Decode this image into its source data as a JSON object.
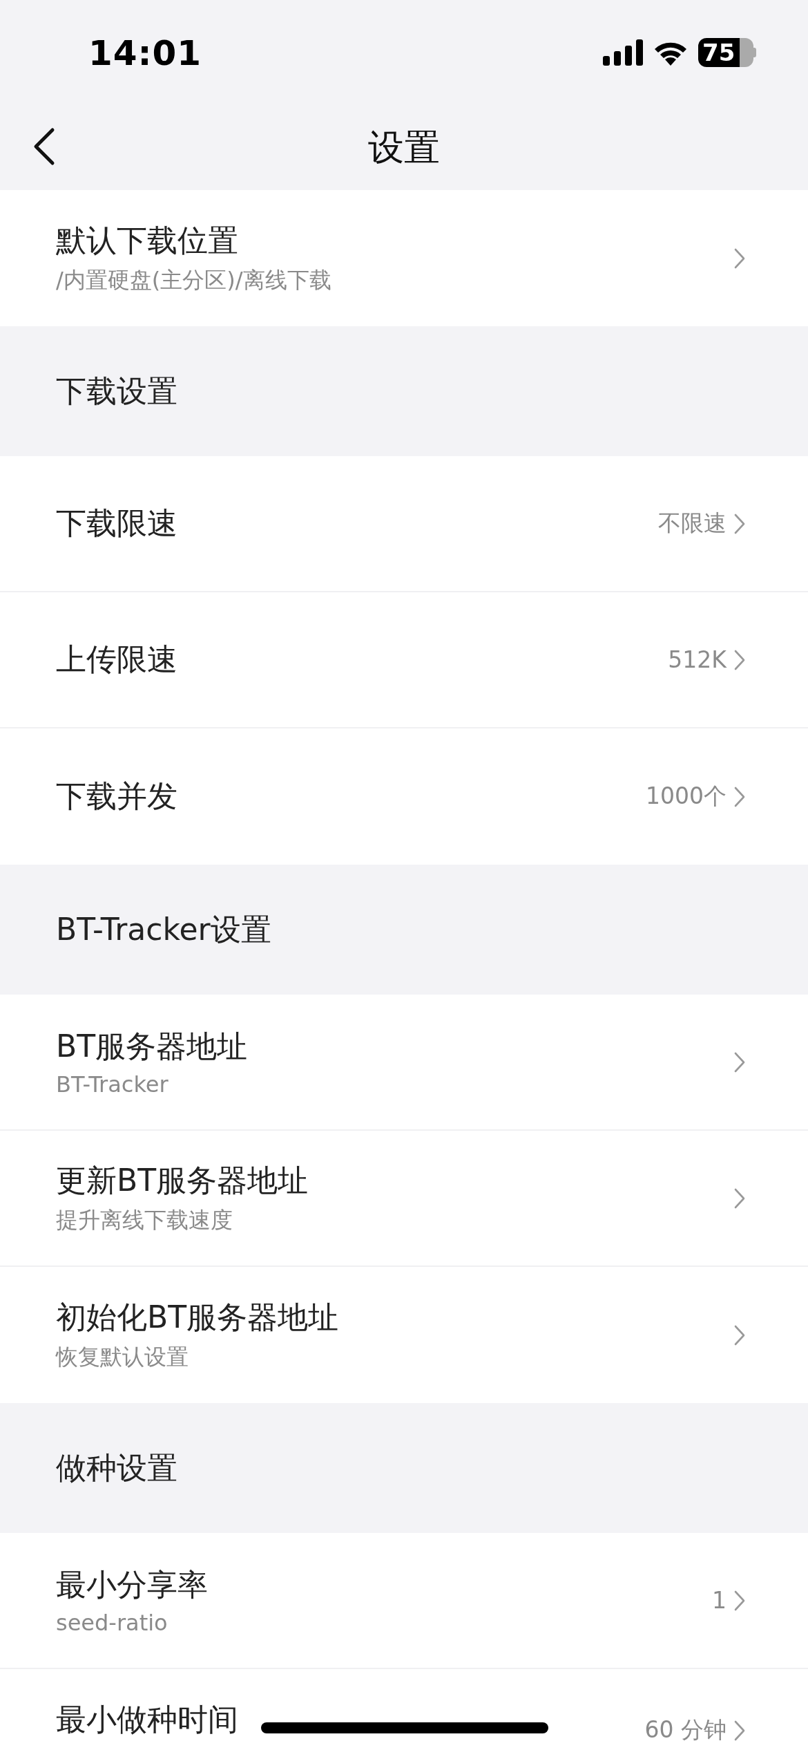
{
  "status_bar": {
    "time": "14:01",
    "battery": "75"
  },
  "nav_bar": {
    "title": "设置"
  },
  "items": [
    {
      "kind": "row",
      "title": "默认下载位置",
      "subtitle": "/内置硬盘(主分区)/离线下载"
    },
    {
      "kind": "section",
      "title": "下载设置"
    },
    {
      "kind": "row",
      "title": "下载限速",
      "value": "不限速"
    },
    {
      "kind": "row",
      "title": "上传限速",
      "value": "512K"
    },
    {
      "kind": "row",
      "title": "下载并发",
      "value": "1000个"
    },
    {
      "kind": "section",
      "title": "BT-Tracker设置"
    },
    {
      "kind": "row",
      "title": "BT服务器地址",
      "subtitle": "BT-Tracker"
    },
    {
      "kind": "row",
      "title": "更新BT服务器地址",
      "subtitle": "提升离线下载速度"
    },
    {
      "kind": "row",
      "title": "初始化BT服务器地址",
      "subtitle": "恢复默认设置"
    },
    {
      "kind": "section",
      "title": "做种设置"
    },
    {
      "kind": "row",
      "title": "最小分享率",
      "subtitle": "seed-ratio",
      "value": "1"
    },
    {
      "kind": "row",
      "title": "最小做种时间",
      "value": "60 分钟"
    }
  ]
}
